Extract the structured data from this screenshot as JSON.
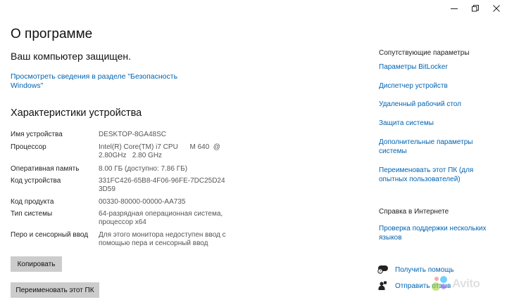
{
  "window": {
    "controls": [
      "minimize-icon",
      "restore-icon",
      "close-icon"
    ]
  },
  "page": {
    "title": "О программе",
    "protection_status": "Ваш компьютер защищен.",
    "security_link": "Просмотреть сведения в разделе \"Безопасность Windows\"",
    "specs_heading": "Характеристики устройства"
  },
  "specs": [
    {
      "label": "Имя устройства",
      "value": "DESKTOP-8GA48SC"
    },
    {
      "label": "Процессор",
      "value": "Intel(R) Core(TM) i7 CPU      M 640  @ 2.80GHz   2.80 GHz"
    },
    {
      "label": "Оперативная память",
      "value": "8.00 ГБ (доступно: 7.86 ГБ)"
    },
    {
      "label": "Код устройства",
      "value": "331FC426-65B8-4F06-96FE-7DC25D243D59"
    },
    {
      "label": "Код продукта",
      "value": "00330-80000-00000-AA735"
    },
    {
      "label": "Тип системы",
      "value": "64-разрядная операционная система, процессор x64"
    },
    {
      "label": "Перо и сенсорный ввод",
      "value": "Для этого монитора недоступен ввод с помощью пера и сенсорный ввод"
    }
  ],
  "buttons": {
    "copy": "Копировать",
    "rename": "Переименовать этот ПК"
  },
  "related": {
    "heading": "Сопутствующие параметры",
    "links": [
      "Параметры BitLocker",
      "Диспетчер устройств",
      "Удаленный рабочий стол",
      "Защита системы",
      "Дополнительные параметры системы",
      "Переименовать этот ПК (для опытных пользователей)"
    ]
  },
  "web_help": {
    "heading": "Справка в Интернете",
    "links": [
      "Проверка поддержки нескольких языков"
    ]
  },
  "help": {
    "get_help": "Получить помощь",
    "feedback": "Отправить отзыв",
    "get_help_icon": "chat-help-icon",
    "feedback_icon": "feedback-person-icon"
  },
  "watermark": {
    "text": "Avito",
    "colors": [
      "#97cf26",
      "#a169f7",
      "#ff6163",
      "#00aaff"
    ]
  },
  "colors": {
    "link": "#0063b1",
    "button_bg": "#cccccc",
    "label": "#222222",
    "value": "#555555"
  }
}
